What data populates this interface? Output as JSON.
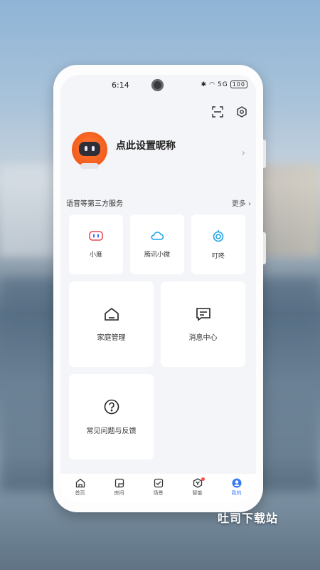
{
  "status_bar": {
    "time": "6:14",
    "signal": "5G",
    "battery": "100"
  },
  "top_actions": {
    "scan_icon": "scan-icon",
    "settings_icon": "settings-hex-icon"
  },
  "profile": {
    "nickname": "点此设置昵称"
  },
  "services": {
    "title": "语音等第三方服务",
    "more": "更多",
    "items": [
      {
        "label": "小度",
        "icon": "xiaodu-icon",
        "color": "#3b6cf6"
      },
      {
        "label": "腾讯小微",
        "icon": "cloud-icon",
        "color": "#1fa3e8"
      },
      {
        "label": "叮咚",
        "icon": "dingdong-icon",
        "color": "#1fa3e8"
      }
    ]
  },
  "tiles": [
    {
      "label": "家庭管理",
      "icon": "home-icon"
    },
    {
      "label": "消息中心",
      "icon": "message-icon"
    },
    {
      "label": "常见问题与反馈",
      "icon": "help-icon"
    }
  ],
  "tabbar": {
    "items": [
      {
        "label": "首页",
        "icon": "home-tab-icon"
      },
      {
        "label": "房间",
        "icon": "room-tab-icon"
      },
      {
        "label": "场景",
        "icon": "scene-tab-icon"
      },
      {
        "label": "智能",
        "icon": "smart-tab-icon"
      },
      {
        "label": "我的",
        "icon": "mine-tab-icon"
      }
    ],
    "active": "我的",
    "accent": "#3b7bf6"
  },
  "watermark": "吐司下载站"
}
